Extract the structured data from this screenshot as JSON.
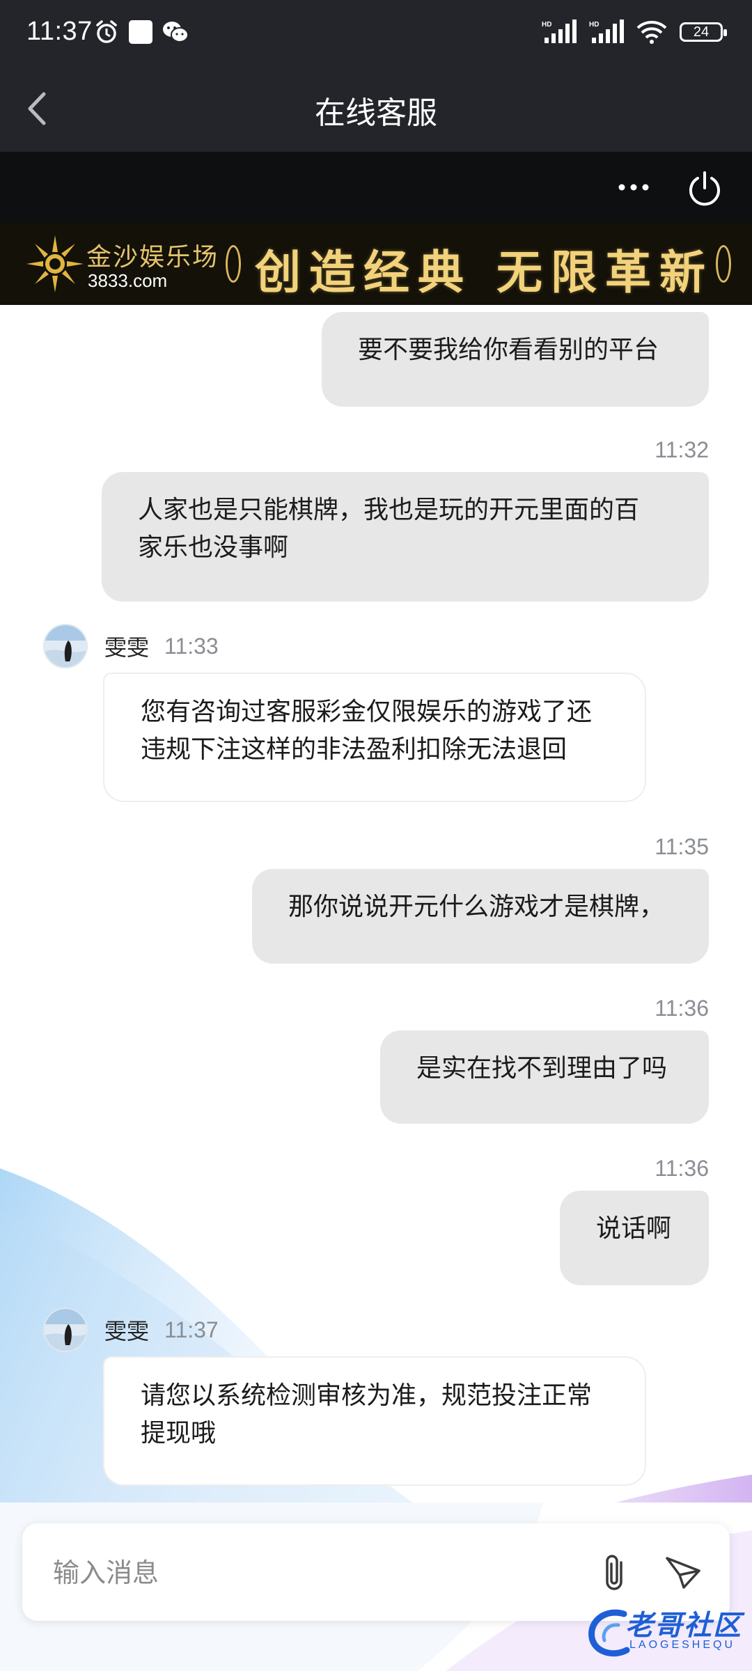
{
  "status_bar": {
    "time": "11:37",
    "battery": "24",
    "icons_left": [
      "alarm-icon",
      "app-square-icon",
      "wechat-icon"
    ],
    "icons_right": [
      "hd-signal-icon",
      "hd-signal-icon",
      "wifi-icon",
      "battery-icon"
    ]
  },
  "nav": {
    "title": "在线客服",
    "back_icon": "chevron-left-icon"
  },
  "toolbar": {
    "more_icon": "more-dots-icon",
    "power_icon": "power-icon"
  },
  "banner": {
    "brand": "金沙娱乐场",
    "url": "3833.com",
    "slogan": "创造经典 无限革新"
  },
  "messages": [
    {
      "from": "me",
      "time": "",
      "text": "要不要我给你看看别的平台"
    },
    {
      "from": "me",
      "time": "11:32",
      "line1": "人家也是只能棋牌，我也是玩的开元里面的百",
      "line2": "家乐也没事啊"
    },
    {
      "from": "agent",
      "name": "雯雯",
      "time": "11:33",
      "line1": "您有咨询过客服彩金仅限娱乐的游戏了还",
      "line2": "违规下注这样的非法盈利扣除无法退回"
    },
    {
      "from": "me",
      "time": "11:35",
      "text": "那你说说开元什么游戏才是棋牌，"
    },
    {
      "from": "me",
      "time": "11:36",
      "text": "是实在找不到理由了吗"
    },
    {
      "from": "me",
      "time": "11:36",
      "text": "说话啊"
    },
    {
      "from": "agent",
      "name": "雯雯",
      "time": "11:37",
      "line1": "请您以系统检测审核为准，规范投注正常",
      "line2": "提现哦"
    }
  ],
  "input": {
    "placeholder": "输入消息",
    "attach_icon": "paperclip-icon",
    "send_icon": "send-icon"
  },
  "watermark": {
    "text": "老哥社区",
    "sub": "LAOGESHEQU"
  },
  "colors": {
    "header_bg": "#23252a",
    "toolbar_bg": "#0e0f11",
    "my_bubble": "#e7e7e8",
    "agent_bubble": "#ffffff",
    "banner_gold": "#f2d27a"
  }
}
